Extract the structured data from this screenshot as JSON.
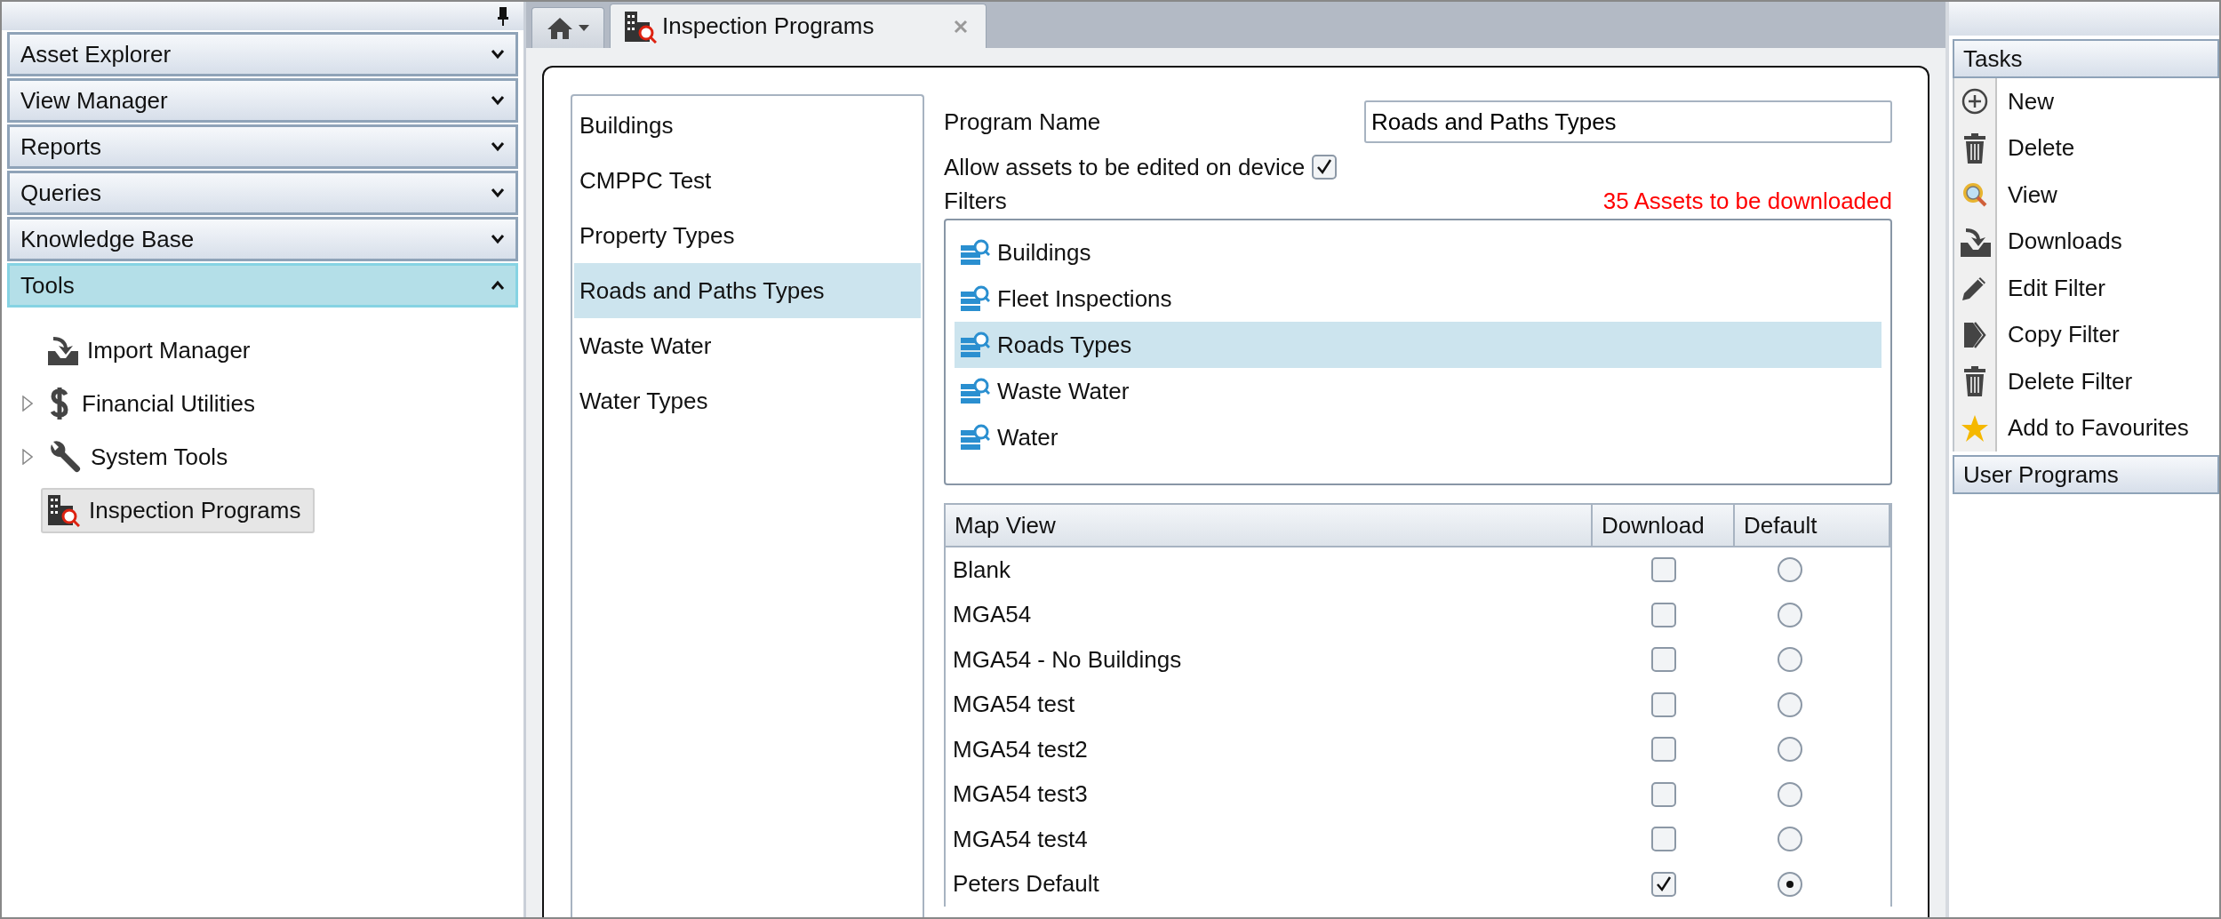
{
  "left_panel": {
    "accordion": [
      {
        "label": "Asset Explorer",
        "expanded": false
      },
      {
        "label": "View Manager",
        "expanded": false
      },
      {
        "label": "Reports",
        "expanded": false
      },
      {
        "label": "Queries",
        "expanded": false
      },
      {
        "label": "Knowledge Base",
        "expanded": false
      },
      {
        "label": "Tools",
        "expanded": true
      }
    ],
    "tree": [
      {
        "label": "Import Manager",
        "kind": "import",
        "expandable": false,
        "selected": false
      },
      {
        "label": "Financial Utilities",
        "kind": "dollar",
        "expandable": true,
        "selected": false
      },
      {
        "label": "System Tools",
        "kind": "wrench",
        "expandable": true,
        "selected": false
      },
      {
        "label": "Inspection Programs",
        "kind": "building",
        "expandable": false,
        "selected": true
      }
    ]
  },
  "tabs": [
    {
      "label": "Inspection Programs",
      "selected": true
    }
  ],
  "programs": [
    {
      "label": "Buildings",
      "selected": false
    },
    {
      "label": "CMPPC Test",
      "selected": false
    },
    {
      "label": "Property Types",
      "selected": false
    },
    {
      "label": "Roads and Paths Types",
      "selected": true
    },
    {
      "label": "Waste Water",
      "selected": false
    },
    {
      "label": "Water Types",
      "selected": false
    }
  ],
  "program_name": {
    "label": "Program Name",
    "value": "Roads and Paths Types"
  },
  "allow_edit": {
    "label": "Allow assets to be edited on device",
    "checked": true
  },
  "filters": {
    "label": "Filters",
    "summary": "35 Assets to be downloaded",
    "items": [
      {
        "label": "Buildings",
        "selected": false
      },
      {
        "label": "Fleet Inspections",
        "selected": false
      },
      {
        "label": "Roads Types",
        "selected": true
      },
      {
        "label": "Waste Water",
        "selected": false
      },
      {
        "label": "Water",
        "selected": false
      }
    ]
  },
  "map_table": {
    "columns": [
      "Map View",
      "Download",
      "Default"
    ],
    "rows": [
      {
        "name": "Blank",
        "download": false,
        "default": false
      },
      {
        "name": "MGA54",
        "download": false,
        "default": false
      },
      {
        "name": "MGA54 - No Buildings",
        "download": false,
        "default": false
      },
      {
        "name": "MGA54 test",
        "download": false,
        "default": false
      },
      {
        "name": "MGA54 test2",
        "download": false,
        "default": false
      },
      {
        "name": "MGA54 test3",
        "download": false,
        "default": false
      },
      {
        "name": "MGA54 test4",
        "download": false,
        "default": false
      },
      {
        "name": "Peters Default",
        "download": true,
        "default": true
      }
    ]
  },
  "tasks_panel": {
    "title": "Tasks",
    "items": [
      {
        "label": "New",
        "kind": "plus"
      },
      {
        "label": "Delete",
        "kind": "trash"
      },
      {
        "label": "View",
        "kind": "view"
      },
      {
        "label": "Downloads",
        "kind": "import"
      },
      {
        "label": "Edit Filter",
        "kind": "pencil"
      },
      {
        "label": "Copy Filter",
        "kind": "copy"
      },
      {
        "label": "Delete Filter",
        "kind": "trash"
      },
      {
        "label": "Add to Favourites",
        "kind": "star"
      }
    ]
  },
  "user_programs": {
    "title": "User Programs"
  }
}
